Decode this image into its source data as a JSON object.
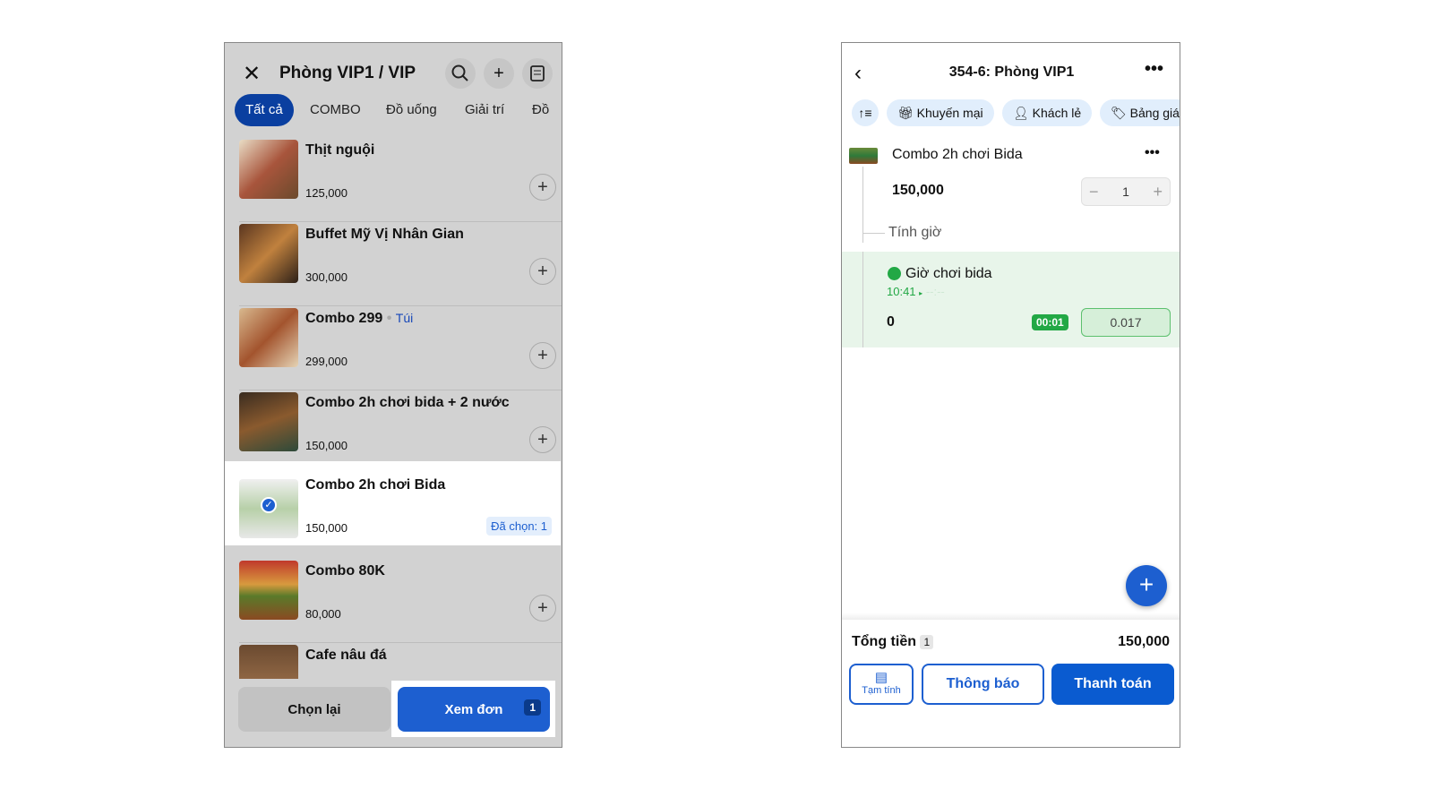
{
  "left": {
    "title": "Phòng VIP1 / VIP",
    "tabs": [
      "Tất cả",
      "COMBO",
      "Đồ uống",
      "Giải trí",
      "Đồ"
    ],
    "items": [
      {
        "name": "Thịt nguội",
        "price": "125,000"
      },
      {
        "name": "Buffet Mỹ Vị Nhân Gian",
        "price": "300,000"
      },
      {
        "name": "Combo 299",
        "tag": "Túi",
        "price": "299,000"
      },
      {
        "name": "Combo 2h chơi bida + 2 nước",
        "price": "150,000"
      },
      {
        "name": "Combo 2h chơi Bida",
        "price": "150,000",
        "selected_label": "Đã chọn: 1"
      },
      {
        "name": "Combo 80K",
        "price": "80,000"
      },
      {
        "name": "Cafe nâu đá"
      }
    ],
    "reset_label": "Chọn lại",
    "view_order_label": "Xem đơn",
    "view_order_count": "1"
  },
  "right": {
    "title": "354-6: Phòng VIP1",
    "chips": [
      "Khuyến mại",
      "Khách lẻ",
      "Bảng giá"
    ],
    "order_item": {
      "name": "Combo 2h chơi Bida",
      "price": "150,000",
      "qty": "1",
      "sub_label": "Tính giờ"
    },
    "timer": {
      "name": "Giờ chơi bida",
      "start": "10:41",
      "end": "--:--",
      "amount": "0",
      "duration": "00:01",
      "hours": "0.017"
    },
    "total_label": "Tổng tiền",
    "total_count": "1",
    "total": "150,000",
    "temp_label": "Tạm tính",
    "notify_label": "Thông báo",
    "pay_label": "Thanh toán"
  }
}
